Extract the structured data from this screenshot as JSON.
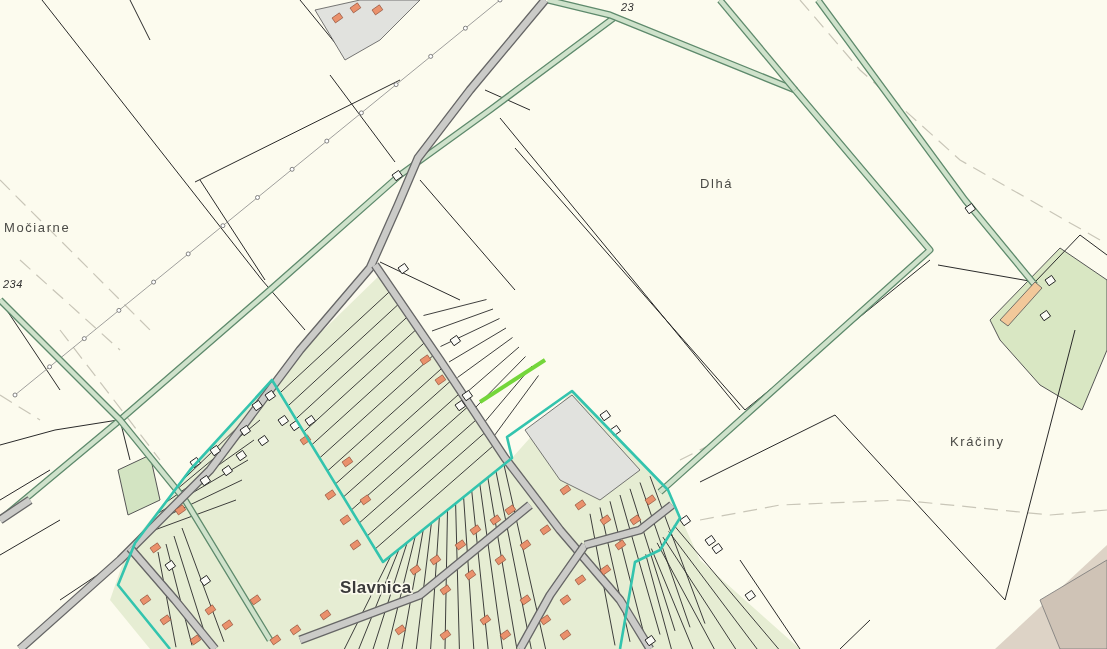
{
  "map": {
    "labels": [
      {
        "text": "23",
        "kind": "elevation"
      },
      {
        "text": "Dlhá",
        "kind": "locality"
      },
      {
        "text": "Močiarne",
        "kind": "locality"
      },
      {
        "text": "234",
        "kind": "elevation"
      },
      {
        "text": "Kráčiny",
        "kind": "locality"
      },
      {
        "text": "Slavnica",
        "kind": "village"
      }
    ]
  }
}
